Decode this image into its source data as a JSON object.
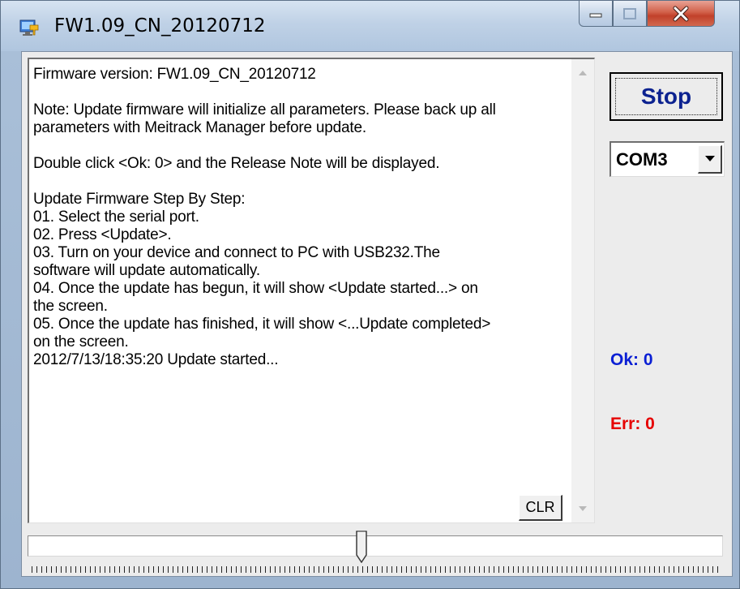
{
  "window": {
    "title": "FW1.09_CN_20120712"
  },
  "log": {
    "lines": [
      "Firmware version: FW1.09_CN_20120712",
      "",
      "Note: Update firmware will initialize all parameters. Please back up all",
      "parameters with Meitrack Manager before update.",
      "",
      "Double click <Ok: 0> and the Release Note will be displayed.",
      "",
      "Update Firmware Step By Step:",
      "01. Select the serial port.",
      "02. Press <Update>.",
      "03. Turn on your device and connect to PC with USB232.The",
      "software will update automatically.",
      "04. Once the update has begun, it will show <Update started...> on",
      "the screen.",
      "05. Once the update has finished, it will show <...Update completed>",
      "on the screen.",
      "2012/7/13/18:35:20 Update started..."
    ],
    "clear_label": "CLR"
  },
  "controls": {
    "stop_label": "Stop",
    "port_selected": "COM3"
  },
  "status": {
    "ok_label": "Ok: 0",
    "err_label": "Err: 0",
    "ok_color": "#0a1fd4",
    "err_color": "#e60000"
  },
  "progress": {
    "fraction": 0.48
  },
  "icons": {
    "app": "firmware-update-icon",
    "minimize": "minimize-icon",
    "maximize": "maximize-icon",
    "close": "close-icon"
  }
}
